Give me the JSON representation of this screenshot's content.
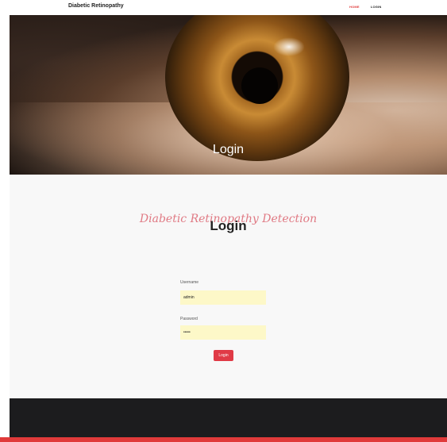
{
  "navbar": {
    "brand": "Diabetic Retinopathy",
    "links": [
      {
        "label": "HOME",
        "active": true
      },
      {
        "label": "LOGIN",
        "active": false
      }
    ]
  },
  "hero": {
    "title": "Login"
  },
  "form": {
    "script_heading": "Diabetic Retinopathy Detection",
    "title": "Login",
    "username_label": "Username",
    "username_value": "admin",
    "password_label": "Password",
    "password_value": "•••••",
    "submit_label": "Login"
  },
  "colors": {
    "accent": "#e03a3a",
    "input_bg": "#fdf8c8",
    "footer_bg": "#1c1c1e"
  }
}
